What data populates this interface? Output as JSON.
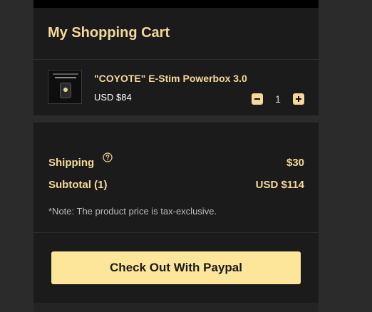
{
  "cart": {
    "title": "My Shopping Cart"
  },
  "item": {
    "name": "\"COYOTE\" E-Stim Powerbox 3.0",
    "price": "USD $84",
    "quantity": "1",
    "minus_icon": "minus-icon",
    "plus_icon": "plus-icon"
  },
  "summary": {
    "shipping_label": "Shipping",
    "shipping_value": "$30",
    "help_icon": "question-circle-icon",
    "subtotal_label": "Subtotal (1)",
    "subtotal_value": "USD $114",
    "note": "*Note: The product price is tax-exclusive."
  },
  "checkout": {
    "label": "Check Out With Paypal"
  },
  "colors": {
    "accent": "#f5d999",
    "button": "#fde69a",
    "panel": "#1b1b1b",
    "background": "#2b2b2b"
  }
}
